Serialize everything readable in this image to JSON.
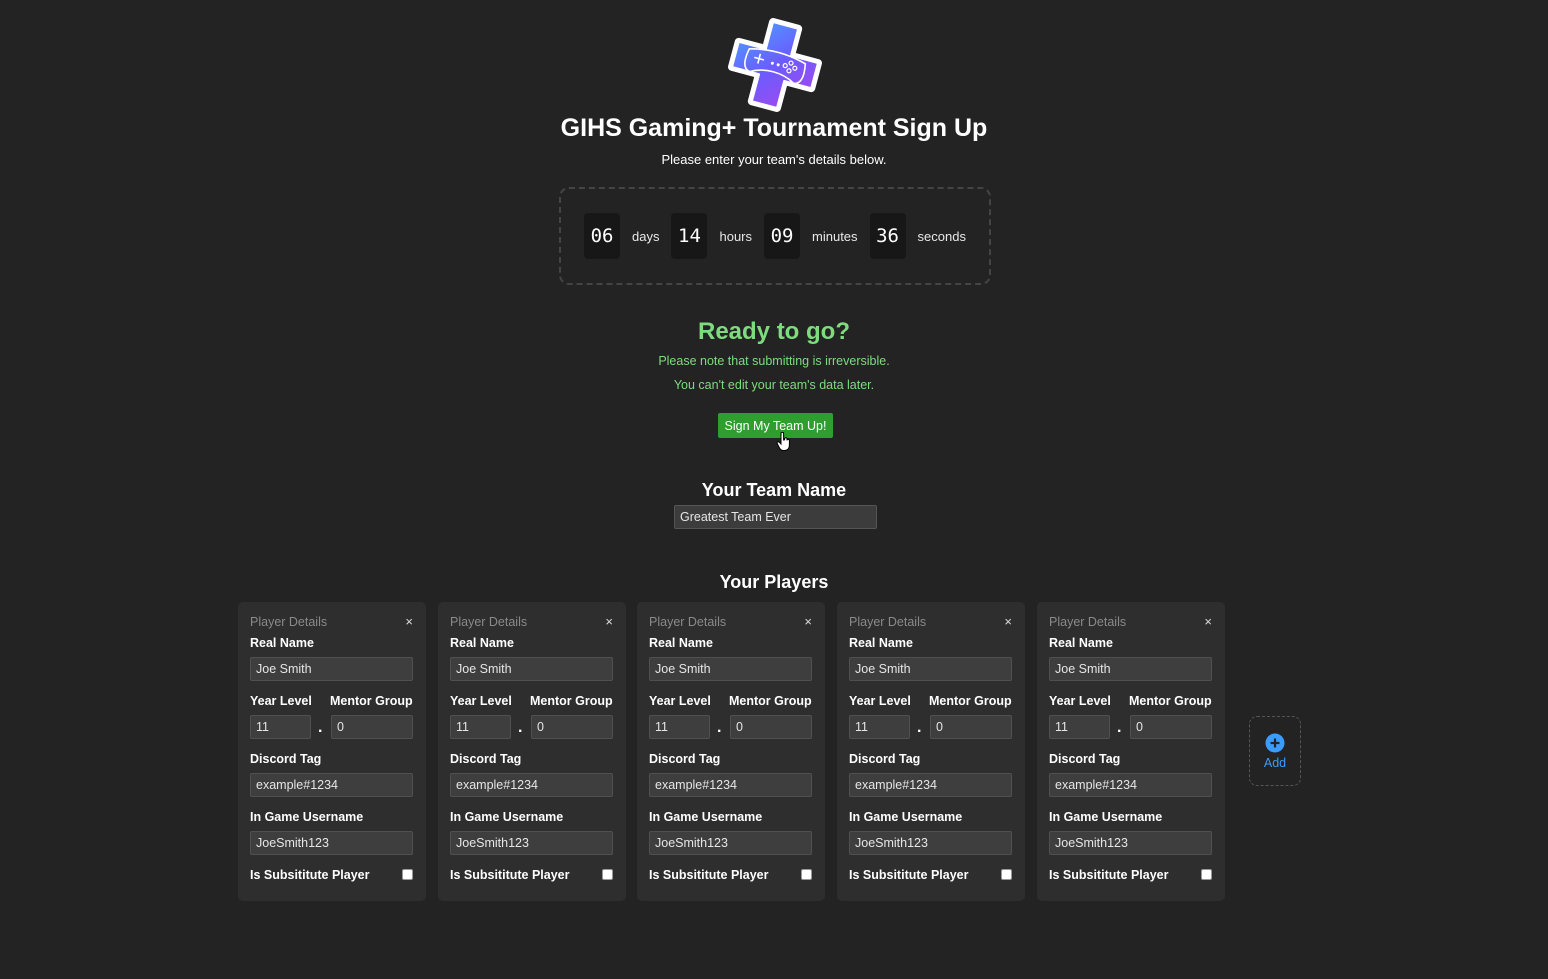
{
  "header": {
    "logo_icon": "gamepad-plus-logo",
    "title": "GIHS Gaming+ Tournament Sign Up",
    "subtitle": "Please enter your team's details below."
  },
  "countdown": {
    "days": "06",
    "days_label": "days",
    "hours": "14",
    "hours_label": "hours",
    "minutes": "09",
    "minutes_label": "minutes",
    "seconds": "36",
    "seconds_label": "seconds"
  },
  "ready": {
    "title": "Ready to go?",
    "line1": "Please note that submitting is irreversible.",
    "line2": "You can't edit your team's data later.",
    "button": "Sign My Team Up!",
    "accent": "#7ddc7d",
    "button_color": "#2e9e2e"
  },
  "team": {
    "heading": "Your Team Name",
    "value": "Greatest Team Ever"
  },
  "players_section": {
    "heading": "Your Players",
    "add_label": "Add",
    "add_icon": "plus-circle-icon",
    "add_color": "#3b9cff"
  },
  "labels": {
    "card_header": "Player Details",
    "close": "×",
    "real_name": "Real Name",
    "year_level": "Year Level",
    "mentor_group": "Mentor Group",
    "separator": ".",
    "discord_tag": "Discord Tag",
    "ign": "In Game Username",
    "substitute": "Is Subsititute Player"
  },
  "players": [
    {
      "real_name": "Joe Smith",
      "year_level": "11",
      "mentor_group": "0",
      "discord_tag": "example#1234",
      "ign": "JoeSmith123",
      "substitute": false
    },
    {
      "real_name": "Joe Smith",
      "year_level": "11",
      "mentor_group": "0",
      "discord_tag": "example#1234",
      "ign": "JoeSmith123",
      "substitute": false
    },
    {
      "real_name": "Joe Smith",
      "year_level": "11",
      "mentor_group": "0",
      "discord_tag": "example#1234",
      "ign": "JoeSmith123",
      "substitute": false
    },
    {
      "real_name": "Joe Smith",
      "year_level": "11",
      "mentor_group": "0",
      "discord_tag": "example#1234",
      "ign": "JoeSmith123",
      "substitute": false
    },
    {
      "real_name": "Joe Smith",
      "year_level": "11",
      "mentor_group": "0",
      "discord_tag": "example#1234",
      "ign": "JoeSmith123",
      "substitute": false
    }
  ]
}
